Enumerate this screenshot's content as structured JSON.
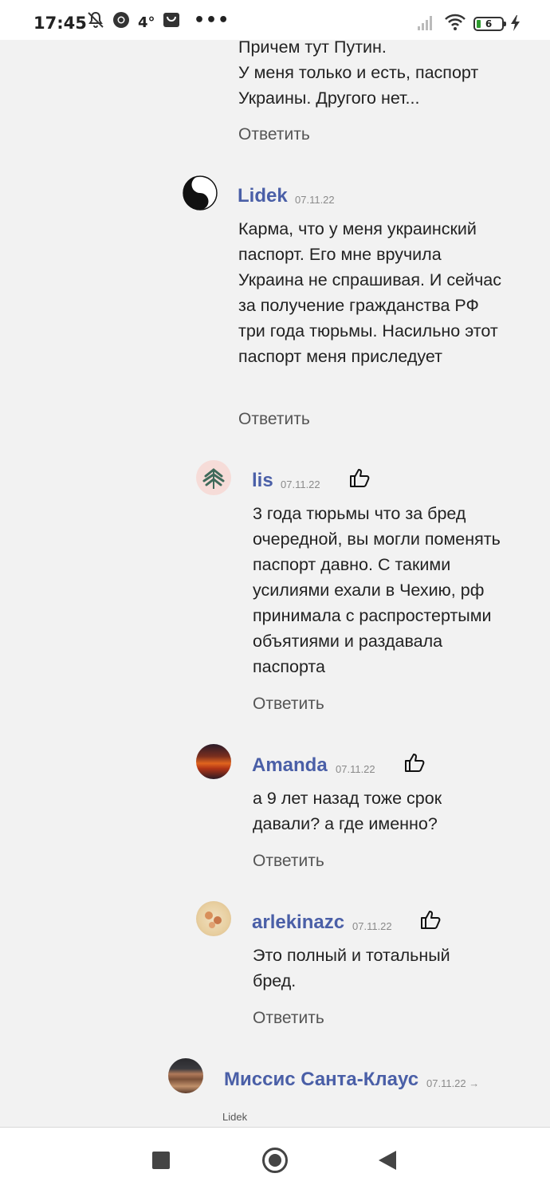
{
  "statusbar": {
    "time": "17:45",
    "temperature": "4°",
    "more": "•••",
    "battery_level": "6"
  },
  "comments": [
    {
      "text": "Причем тут Путин.\nУ меня только и есть, паспорт Украины. Другого нет...",
      "reply_label": "Ответить"
    },
    {
      "author": "Lidek",
      "date": "07.11.22",
      "text": "Карма, что у меня украинский паспорт. Его мне вручила Украина не спрашивая. И сейчас за получение гражданства РФ три года тюрьмы. Насильно этот паспорт меня приследует",
      "reply_label": "Ответить"
    },
    {
      "author": "lis",
      "date": "07.11.22",
      "text": "3 года тюрьмы что за бред очередной, вы могли поменять паспорт давно. С такими усилиями ехали в Чехию, рф принимала с распростертыми объятиями и раздавала паспорта",
      "reply_label": "Ответить"
    },
    {
      "author": "Amanda",
      "date": "07.11.22",
      "text": "а 9 лет назад тоже срок давали? а где именно?",
      "reply_label": "Ответить"
    },
    {
      "author": "arlekinazc",
      "date": "07.11.22",
      "text": "Это полный и тотальный бред.",
      "reply_label": "Ответить"
    },
    {
      "author": "Миссис Санта-Клаус",
      "date": "07.11.22 →",
      "reply_to": "Lidek"
    }
  ],
  "colors": {
    "author": "#4a5fa7",
    "background": "#f2f2f2"
  }
}
